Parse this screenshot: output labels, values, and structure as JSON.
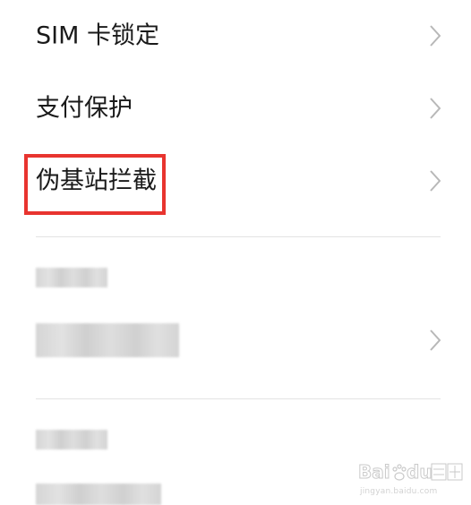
{
  "settings_list": {
    "items": [
      {
        "label": "SIM 卡锁定",
        "has_chevron": true
      },
      {
        "label": "支付保护",
        "has_chevron": true
      },
      {
        "label": "伪基站拦截",
        "has_chevron": true,
        "highlighted": true
      }
    ],
    "blurred_items": [
      {
        "has_chevron": true
      }
    ]
  },
  "colors": {
    "highlight": "#e8342f",
    "chevron": "#b8b8b8",
    "text": "#1a1a1a",
    "divider": "#e3e3e3"
  },
  "icons": {
    "chevron": "chevron-right-icon"
  },
  "watermark": {
    "subtext": "jingyan.baidu.com"
  }
}
